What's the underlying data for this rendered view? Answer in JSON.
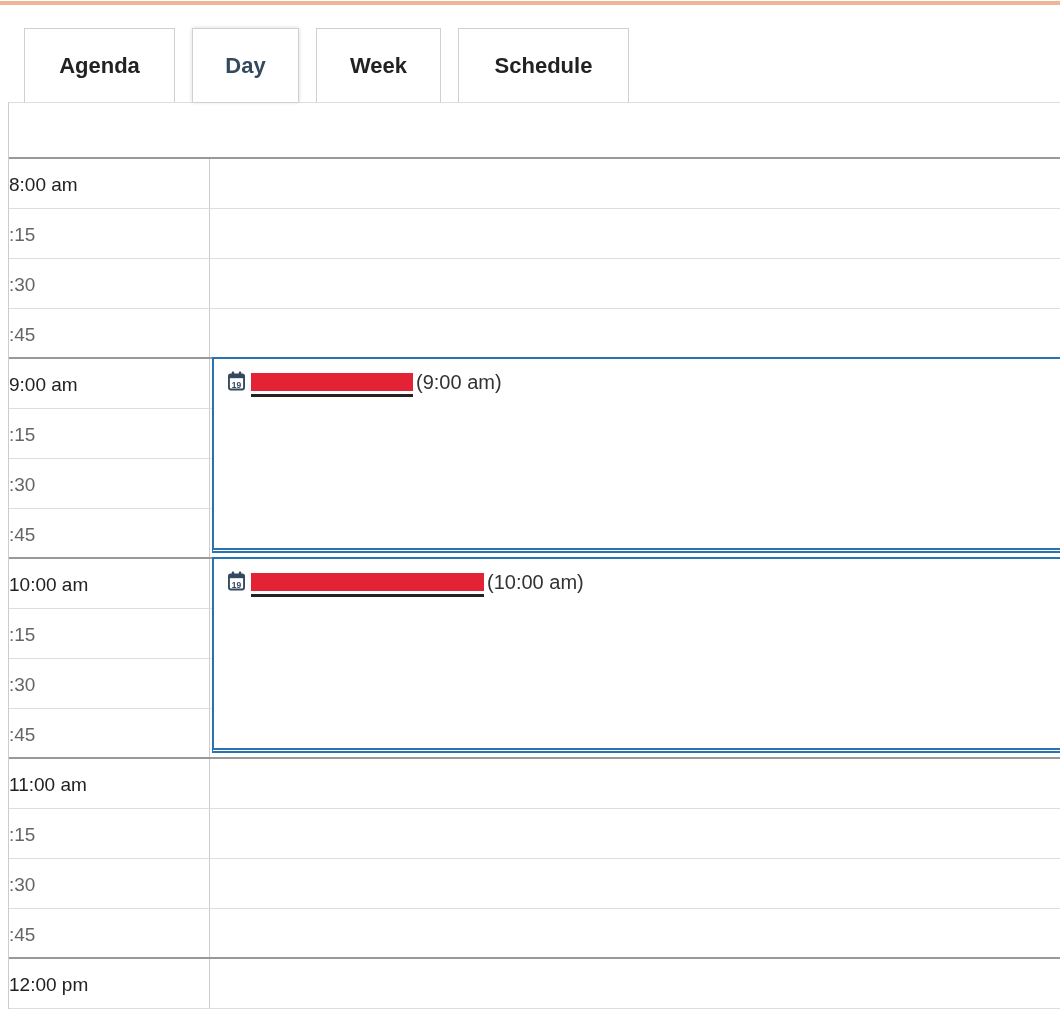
{
  "tabs": [
    {
      "label": "Agenda",
      "selected": false
    },
    {
      "label": "Day",
      "selected": true
    },
    {
      "label": "Week",
      "selected": false
    },
    {
      "label": "Schedule",
      "selected": false
    }
  ],
  "slots": [
    {
      "label": "8:00 am",
      "kind": "hour"
    },
    {
      "label": ":15",
      "kind": "quarter"
    },
    {
      "label": ":30",
      "kind": "quarter"
    },
    {
      "label": ":45",
      "kind": "quarter"
    },
    {
      "label": "9:00 am",
      "kind": "hour"
    },
    {
      "label": ":15",
      "kind": "quarter"
    },
    {
      "label": ":30",
      "kind": "quarter"
    },
    {
      "label": ":45",
      "kind": "quarter"
    },
    {
      "label": "10:00 am",
      "kind": "hour"
    },
    {
      "label": ":15",
      "kind": "quarter"
    },
    {
      "label": ":30",
      "kind": "quarter"
    },
    {
      "label": ":45",
      "kind": "quarter"
    },
    {
      "label": "11:00 am",
      "kind": "hour"
    },
    {
      "label": ":15",
      "kind": "quarter"
    },
    {
      "label": ":30",
      "kind": "quarter"
    },
    {
      "label": ":45",
      "kind": "quarter"
    },
    {
      "label": "12:00 pm",
      "kind": "hour"
    }
  ],
  "events": [
    {
      "icon_day": "19",
      "redacted": true,
      "time": "(9:00 am)"
    },
    {
      "icon_day": "19",
      "redacted": true,
      "time": "(10:00 am)"
    }
  ]
}
